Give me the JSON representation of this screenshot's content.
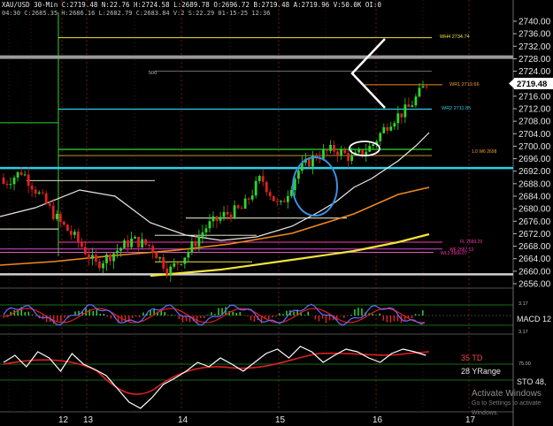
{
  "header": {
    "line1": "XAU/USD 30-Min  C:2719.48  N:22.76  H:2724.58  L:2689.78  O:2696.72  B:2719.48  A:2719.96  V:50.0K  OI:0",
    "line2": "04:30  C:2685.35  H:2686.16  L:2682.79  C:2683.84  V:2  S:22.29  01-15-25  12:36"
  },
  "watermark": {
    "title": "Activate Windows",
    "subtitle": "Go to Settings to activate Windows."
  },
  "price_axis": {
    "ticks": [
      "2740.00",
      "2736.00",
      "2732.00",
      "2728.00",
      "2724.00",
      "2720.00",
      "2716.00",
      "2712.00",
      "2708.00",
      "2704.00",
      "2700.00",
      "2696.00",
      "2692.00",
      "2688.00",
      "2684.00",
      "2680.00",
      "2676.00",
      "2672.00",
      "2668.00",
      "2664.00",
      "2660.00",
      "2656.00"
    ],
    "last_price": "2719.48"
  },
  "level_labels": {
    "wh4": "WH4  2734.74",
    "wr1": "WR1  2719.66",
    "wr2": "WR2  2711.85",
    "five_hundred": "500",
    "fl": "FL  2669.29",
    "wl3": "WL3  2666.07",
    "wf": "WF  2667.12",
    "mid": "1.0  W6  2698"
  },
  "macd": {
    "label": "MACD 12",
    "level_top": "3.17",
    "level_bottom": "3.17"
  },
  "stoch": {
    "td_label": "35 TD",
    "range_label": "28 YRange",
    "sto_label": "STO  48,",
    "level": "75.00"
  },
  "date_axis": {
    "labels": [
      "12",
      "13",
      "14",
      "15",
      "16",
      "17"
    ]
  },
  "colors": {
    "up": "#2fd52f",
    "down": "#e02020",
    "bg": "#000000",
    "cyan": "#2ad0e6",
    "yellow": "#f2e43a",
    "orange": "#f08a1c",
    "magenta": "#ff3ab0",
    "blue_ellipse": "#3a8fe0"
  },
  "chart_data": {
    "type": "line",
    "title": "",
    "xlabel": "",
    "ylabel": "",
    "x": [
      "12",
      "13",
      "14",
      "15",
      "16",
      "17"
    ],
    "ylim": [
      2654,
      2743
    ],
    "series": [
      {
        "values": [
          2688,
          2692,
          2684,
          2676,
          2670,
          2662,
          2666,
          2670,
          2668,
          2660,
          2666,
          2674,
          2678,
          2680,
          2690,
          2680,
          2692,
          2697,
          2699,
          2696,
          2700,
          2708,
          2712,
          2720
        ]
      }
    ],
    "horizontal_levels": [
      2734.74,
      2719.66,
      2711.85,
      2698.0,
      2669.29,
      2667.12,
      2666.07
    ],
    "grid": false
  }
}
